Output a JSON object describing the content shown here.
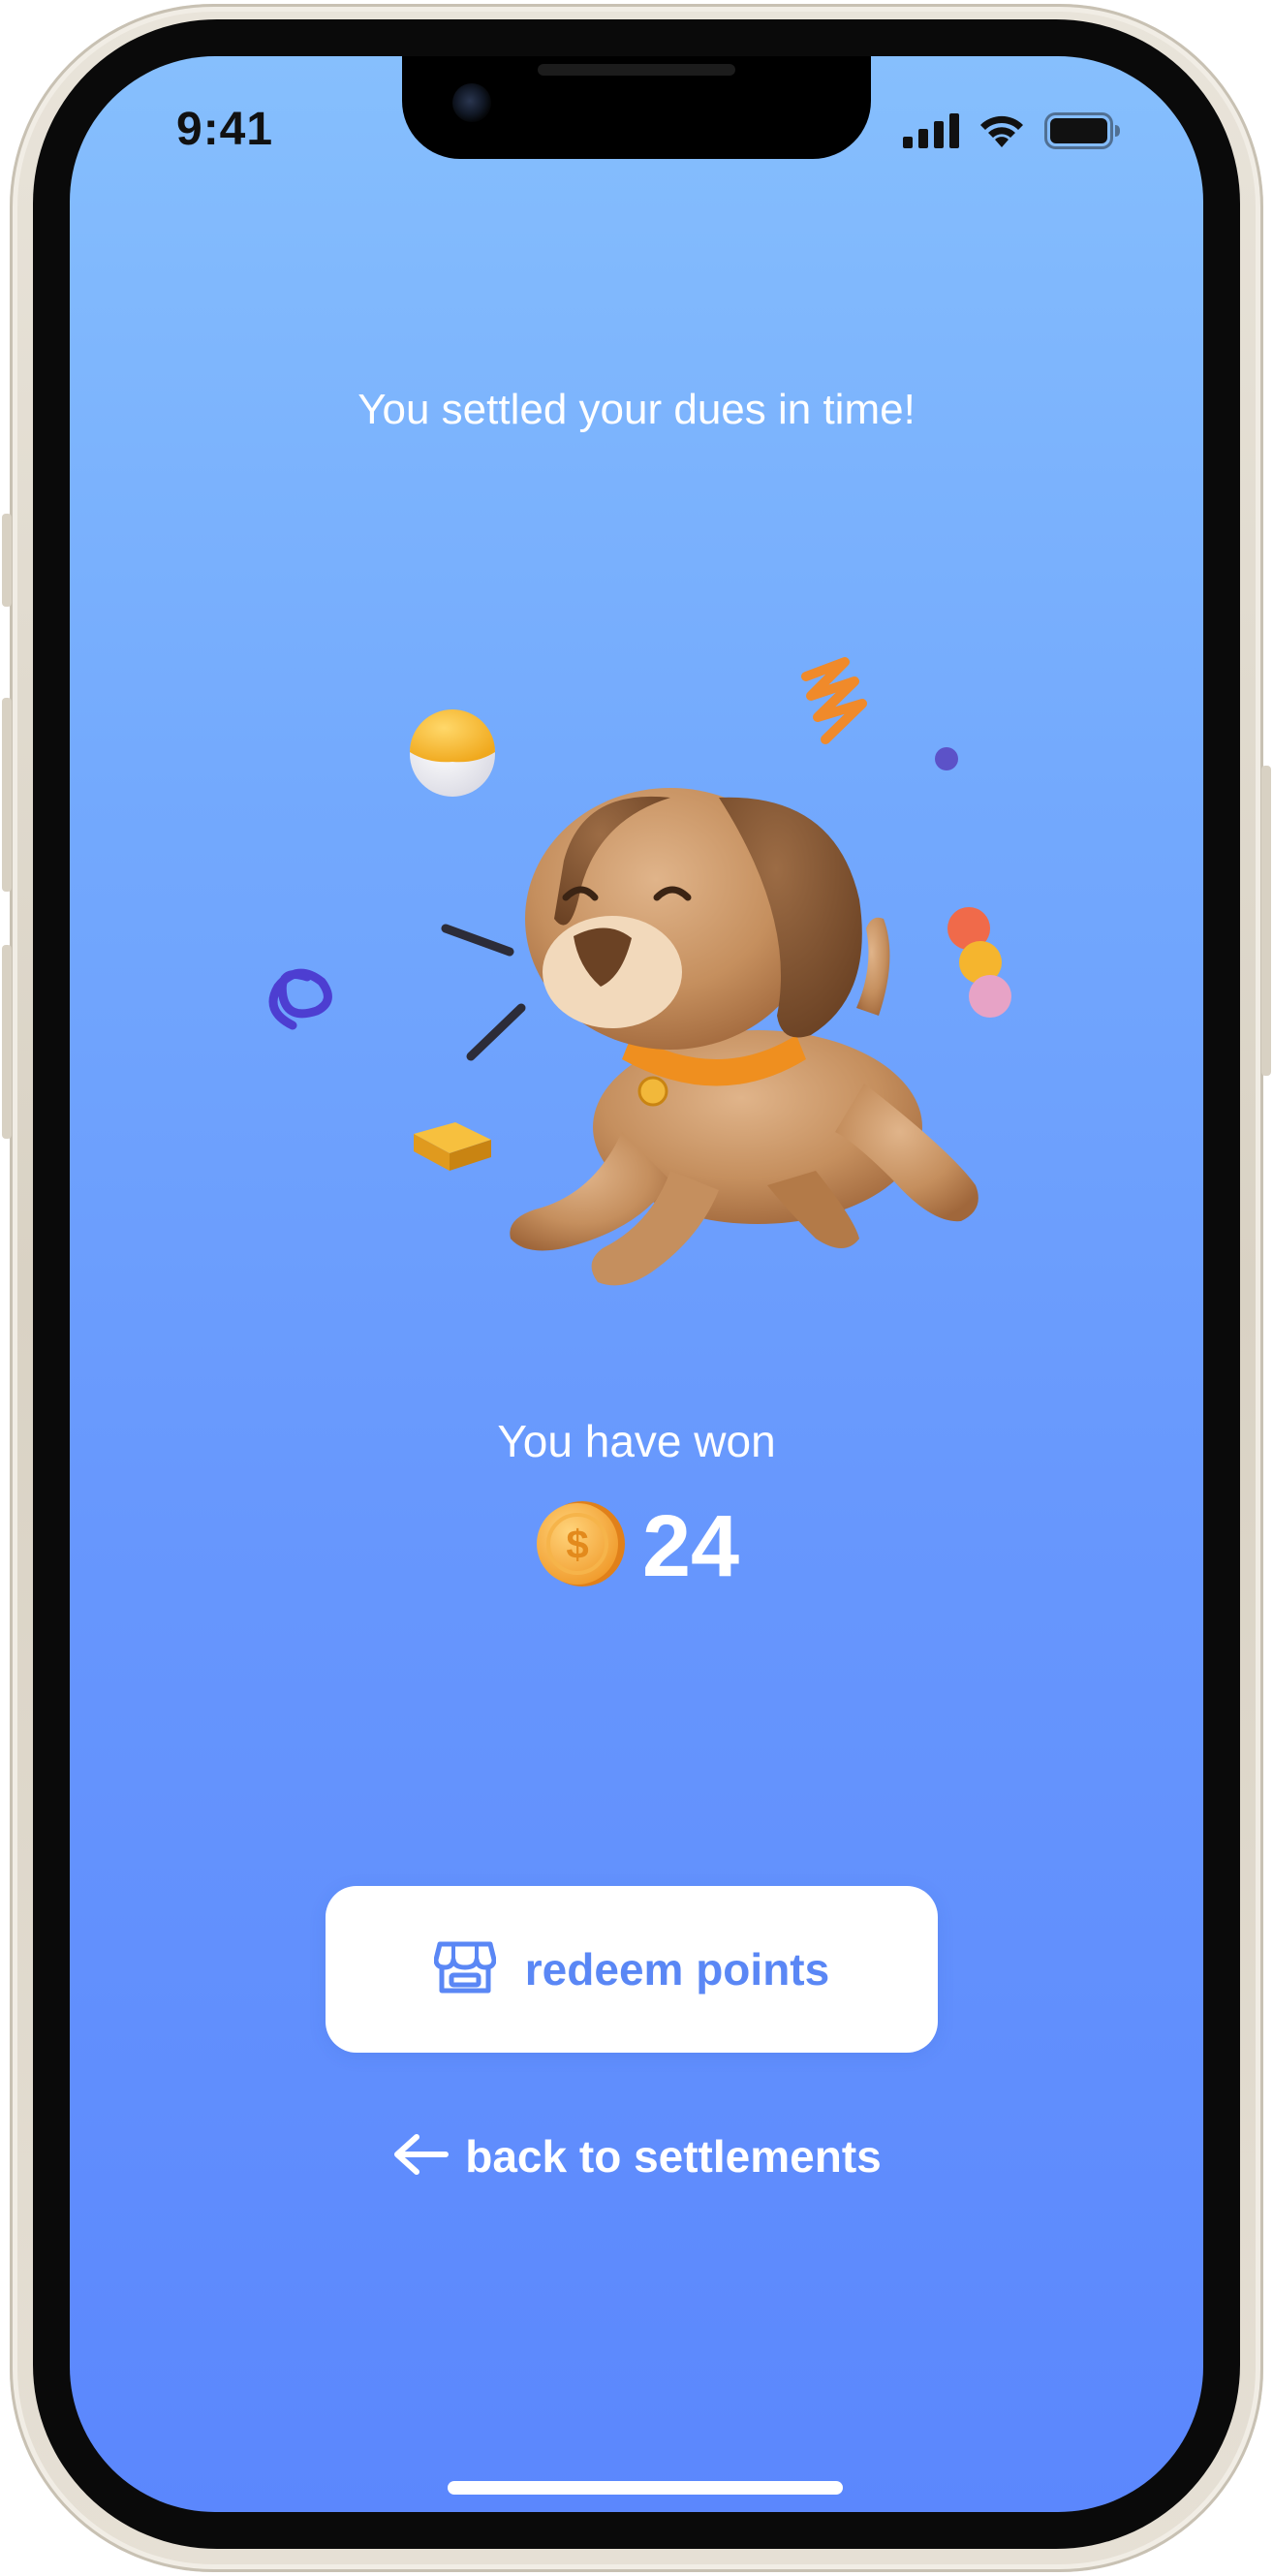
{
  "status_bar": {
    "time": "9:41",
    "icons": [
      "cellular-signal-icon",
      "wifi-icon",
      "battery-icon"
    ]
  },
  "reward": {
    "headline": "You settled your dues in time!",
    "illustration": "happy-dog-illustration",
    "won_label": "You have won",
    "coin_icon": "dollar-coin-icon",
    "points": "24"
  },
  "actions": {
    "redeem_icon": "storefront-icon",
    "redeem_label": "redeem points",
    "back_icon": "arrow-left-icon",
    "back_label": "back to settlements"
  },
  "colors": {
    "gradient_top": "#86bffd",
    "gradient_bottom": "#5b87fd",
    "accent": "#5a87f5",
    "button_bg": "#ffffff"
  }
}
